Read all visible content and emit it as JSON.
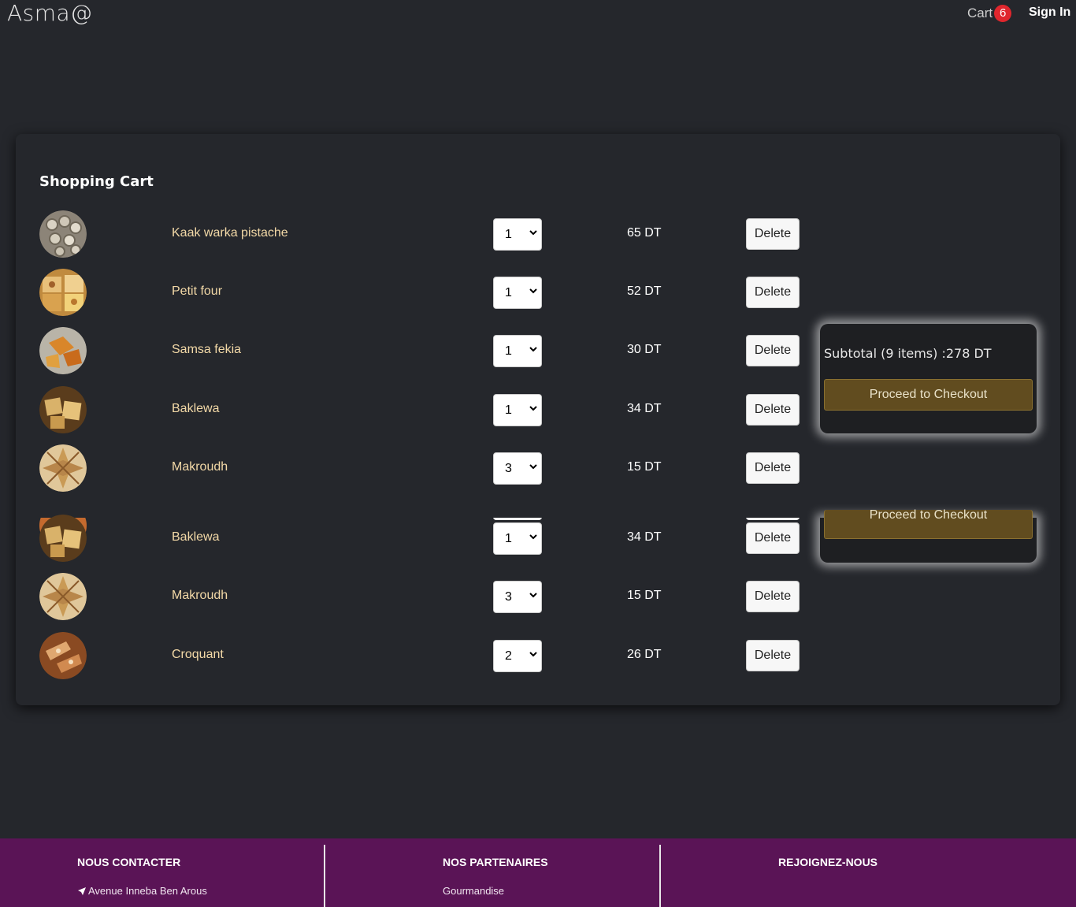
{
  "navbar": {
    "brand": "Asma@",
    "cart_label": "Cart",
    "cart_count": "6",
    "signin_label": "Sign In"
  },
  "cart": {
    "title": "Shopping Cart",
    "items": [
      {
        "name": "Kaak warka pistache",
        "qty": "1",
        "price": "65 DT",
        "delete": "Delete"
      },
      {
        "name": "Petit four",
        "qty": "1",
        "price": "52 DT",
        "delete": "Delete"
      },
      {
        "name": "Samsa fekia",
        "qty": "1",
        "price": "30 DT",
        "delete": "Delete"
      },
      {
        "name": "Baklewa",
        "qty": "1",
        "price": "34 DT",
        "delete": "Delete"
      },
      {
        "name": "Makroudh",
        "qty": "3",
        "price": "15 DT",
        "delete": "Delete"
      },
      {
        "name": "Baklewa",
        "qty": "1",
        "price": "34 DT",
        "delete": "Delete"
      },
      {
        "name": "Makroudh",
        "qty": "3",
        "price": "15 DT",
        "delete": "Delete"
      },
      {
        "name": "Croquant",
        "qty": "2",
        "price": "26 DT",
        "delete": "Delete"
      }
    ]
  },
  "summary": {
    "subtotal": "Subtotal (9 items) :278 DT",
    "checkout": "Proceed to Checkout"
  },
  "footer": {
    "contact_title": "NOUS CONTACTER",
    "contact_address": "Avenue Inneba Ben Arous",
    "partners_title": "NOS PARTENAIRES",
    "partner_1": "Gourmandise",
    "join_title": "REJOIGNEZ-NOUS"
  },
  "colors": {
    "background": "#25272c",
    "item_name": "#f3d9a7",
    "badge": "#e0262d",
    "checkout": "#614c1f",
    "footer": "#5a1456"
  }
}
